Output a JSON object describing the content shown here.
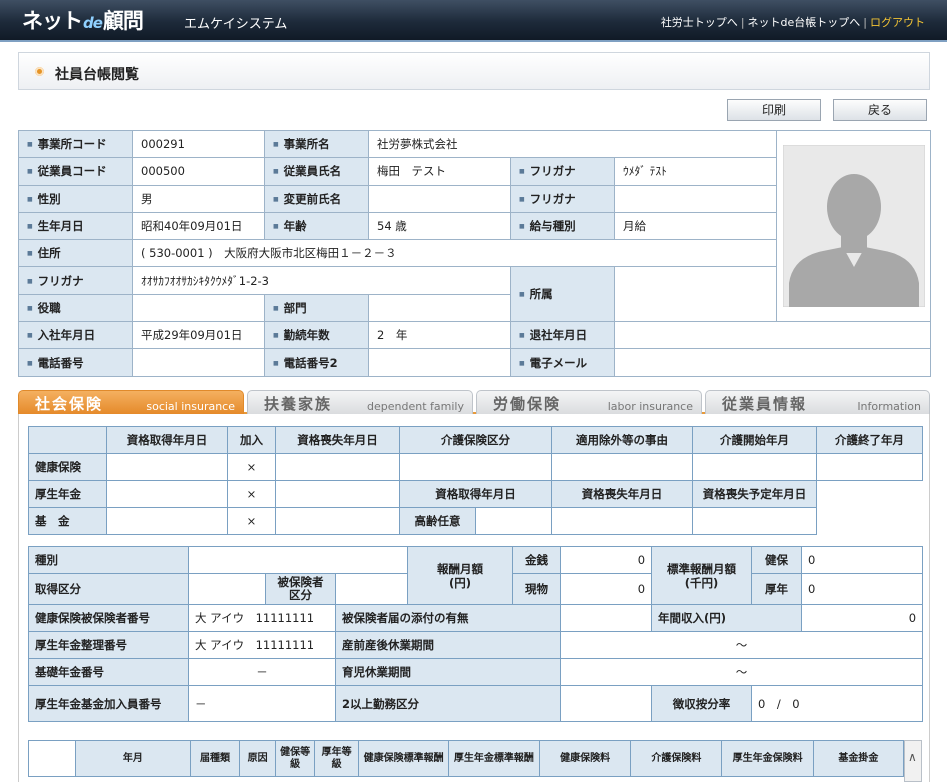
{
  "header": {
    "logo_a": "ネット",
    "logo_de": "de",
    "logo_b": "顧問",
    "brand": "エムケイシステム",
    "nav": [
      "社労士トップへ",
      "ネットde台帳トップへ"
    ],
    "logout": "ログアウト"
  },
  "page": {
    "title": "社員台帳閲覧"
  },
  "toolbar": {
    "print": "印刷",
    "back": "戻る"
  },
  "employee": {
    "lbl_office_code": "事業所コード",
    "office_code": "000291",
    "lbl_office_name": "事業所名",
    "office_name": "社労夢株式会社",
    "lbl_emp_code": "従業員コード",
    "emp_code": "000500",
    "lbl_emp_name": "従業員氏名",
    "emp_name": "梅田　テスト",
    "lbl_kana": "フリガナ",
    "kana": "ｳﾒﾀﾞ ﾃｽﾄ",
    "lbl_gender": "性別",
    "gender": "男",
    "lbl_prev_name": "変更前氏名",
    "prev_name": "",
    "lbl_prev_kana": "フリガナ",
    "prev_kana": "",
    "lbl_birth": "生年月日",
    "birth": "昭和40年09月01日",
    "lbl_age": "年齢",
    "age": "54 歳",
    "lbl_pay_type": "給与種別",
    "pay_type": "月給",
    "lbl_address": "住所",
    "address": "( 530-0001 )　大阪府大阪市北区梅田１－２－３",
    "lbl_addr_kana": "フリガナ",
    "addr_kana": "ｵｵｻｶﾌｵｵｻｶｼｷﾀｸｳﾒﾀﾞ1-2-3",
    "lbl_dept": "所属",
    "dept": "",
    "lbl_position": "役職",
    "position": "",
    "lbl_section": "部門",
    "section": "",
    "lbl_join": "入社年月日",
    "join": "平成29年09月01日",
    "lbl_years": "勤続年数",
    "years": "2　年",
    "lbl_leave": "退社年月日",
    "leave": "",
    "lbl_tel": "電話番号",
    "tel": "",
    "lbl_tel2": "電話番号2",
    "tel2": "",
    "lbl_email": "電子メール",
    "email": ""
  },
  "tabs": [
    {
      "jp": "社会保険",
      "en": "social insurance"
    },
    {
      "jp": "扶養家族",
      "en": "dependent family"
    },
    {
      "jp": "労働保険",
      "en": "labor insurance"
    },
    {
      "jp": "従業員情報",
      "en": "Information"
    }
  ],
  "insurance": {
    "h_acq": "資格取得年月日",
    "h_join": "加入",
    "h_loss": "資格喪失年月日",
    "h_care": "介護保険区分",
    "h_exempt": "適用除外等の事由",
    "h_care_start": "介護開始年月",
    "h_care_end": "介護終了年月",
    "r_health": "健康保険",
    "r_pension": "厚生年金",
    "r_fund": "基　金",
    "x": "×",
    "h_acq2": "資格取得年月日",
    "h_loss2": "資格喪失年月日",
    "h_loss_plan": "資格喪失予定年月日",
    "h_elder": "高齢任意"
  },
  "pay": {
    "l_type": "種別",
    "l_salary": "報酬月額\n(円)",
    "l_cash": "金銭",
    "cash": "0",
    "l_goods": "現物",
    "goods": "0",
    "l_std": "標準報酬月額\n(千円)",
    "l_kenpo": "健保",
    "kenpo": "0",
    "l_kounen": "厚年",
    "kounen": "0",
    "l_acq_type": "取得区分",
    "l_insured_type": "被保険者\n区分",
    "l_health_no": "健康保険被保険者番号",
    "health_no": "大 アイウ　11111111",
    "l_attach": "被保険者届の添付の有無",
    "l_income": "年間収入(円)",
    "income": "0",
    "l_pension_no": "厚生年金整理番号",
    "pension_no": "大 アイウ　11111111",
    "l_maternity": "産前産後休業期間",
    "maternity": "～",
    "l_basic_no": "基礎年金番号",
    "basic_no": "－",
    "l_childcare": "育児休業期間",
    "childcare": "～",
    "l_fund_no": "厚生年金基金加入員番号",
    "fund_no": "－",
    "l_two": "2以上勤務区分",
    "l_ratio": "徴収按分率",
    "ratio": "0　/　0"
  },
  "history": {
    "cols": [
      "年月",
      "届種類",
      "原因",
      "健保等級",
      "厚年等級",
      "健康保険標準報酬",
      "厚生年金標準報酬",
      "健康保険料",
      "介護保険料",
      "厚生年金保険料",
      "基金掛金"
    ]
  },
  "scrollbar": {
    "up": "∧"
  }
}
